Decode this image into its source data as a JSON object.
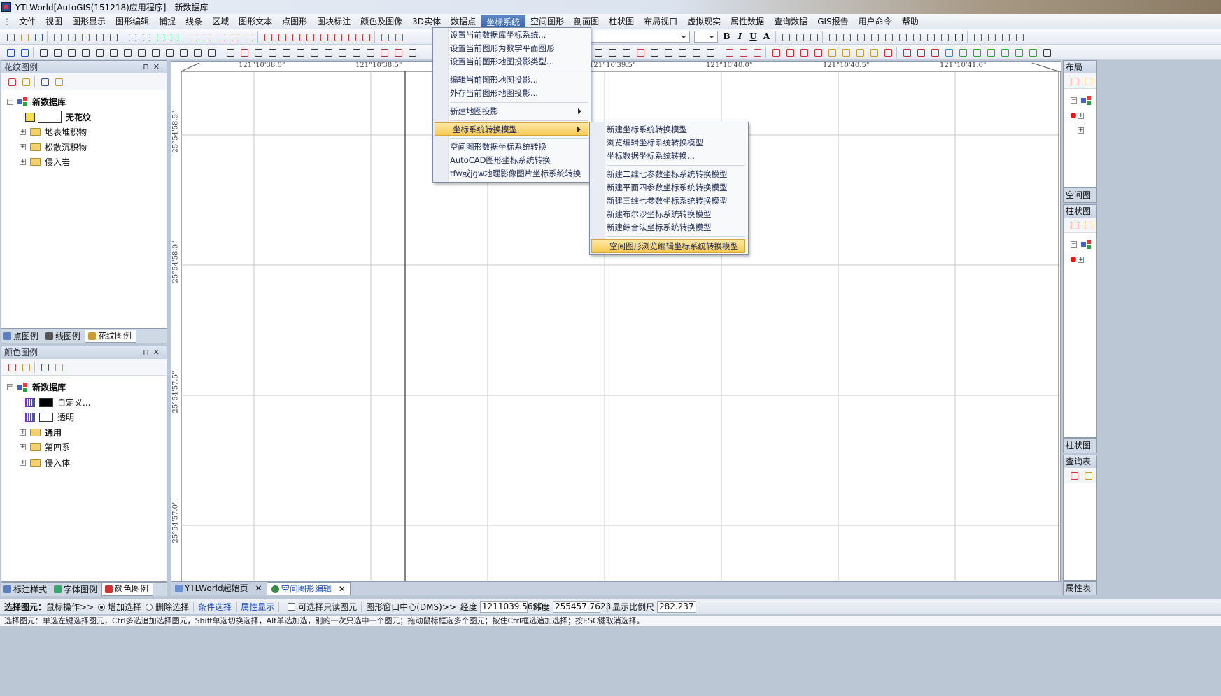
{
  "titlebar": {
    "title": "YTLWorld[AutoGIS(151218)应用程序] - 新数据库"
  },
  "menu": [
    "文件",
    "视图",
    "图形显示",
    "图形编辑",
    "捕捉",
    "线条",
    "区域",
    "图形文本",
    "点图形",
    "图块标注",
    "颜色及图像",
    "3D实体",
    "数据点",
    "坐标系统",
    "空间图形",
    "剖面图",
    "柱状图",
    "布局视口",
    "虚拟现实",
    "属性数据",
    "查询数据",
    "GIS报告",
    "用户命令",
    "帮助"
  ],
  "dropdown": {
    "items": [
      "设置当前数据库坐标系统...",
      "设置当前图形为数学平面图形",
      "设置当前图形地图投影类型...",
      "编辑当前图形地图投影...",
      "外存当前图形地图投影...",
      "新建地图投影",
      "坐标系统转换模型",
      "空间图形数据坐标系统转换",
      "AutoCAD图形坐标系统转换",
      "tfw或jgw地理影像图片坐标系统转换"
    ]
  },
  "submenu": {
    "items": [
      "新建坐标系统转换模型",
      "浏览编辑坐标系统转换模型",
      "坐标数据坐标系统转换...",
      "新建二维七参数坐标系统转换模型",
      "新建平面四参数坐标系统转换模型",
      "新建三维七参数坐标系统转换模型",
      "新建布尔沙坐标系统转换模型",
      "新建综合法坐标系统转换模型",
      "空间图形浏览编辑坐标系统转换模型"
    ]
  },
  "hatch_panel": {
    "title": "花纹图例",
    "root": "新数据库",
    "items": [
      "无花纹",
      "地表堆积物",
      "松散沉积物",
      "侵入岩"
    ]
  },
  "left_tabs_top": [
    "点图例",
    "线图例",
    "花纹图例"
  ],
  "color_panel": {
    "title": "颜色图例",
    "root": "新数据库",
    "items": [
      "自定义...",
      "透明",
      "通用",
      "第四系",
      "侵入体"
    ]
  },
  "left_tabs_bottom": [
    "标注样式",
    "字体图例",
    "颜色图例"
  ],
  "map": {
    "x_ticks": [
      "121°10'38.0\"",
      "121°10'38.5\"",
      "121°10'39.5\"",
      "121°10'40.0\"",
      "121°10'40.5\"",
      "121°10'41.0\""
    ],
    "y_ticks": [
      "25°54'58.5\"",
      "25°54'58.0\"",
      "25°54'57.5\"",
      "25°54'57.0\""
    ]
  },
  "doc_tabs": [
    "YTLWorld起始页",
    "空间图形编辑"
  ],
  "right": {
    "layout": "布局",
    "spatial": "空间图",
    "bar": "柱状图",
    "bar2": "柱状图",
    "query": "查询表",
    "attr": "属性表"
  },
  "status": {
    "label": "选择图元：",
    "mouse_op": "鼠标操作>>",
    "add_select": "增加选择",
    "del_select": "删除选择",
    "cond_select": "条件选择",
    "attr_show": "属性显示",
    "readonly": "可选择只读图元",
    "center_label": "图形窗口中心(DMS)>>",
    "lon_label": "经度",
    "lon": "1211039.5690",
    "lat_label": "纬度",
    "lat": "255457.7623",
    "scale_label": "显示比例尺",
    "scale": "282.237"
  },
  "hint": "选择图元：单选左键选择图元，Ctrl多选追加选择图元，Shift单选切换选择，Alt单选加选，别的一次只选中一个图元；拖动鼠标框选多个图元；按住Ctrl框选追加选择；按ESC键取消选择。"
}
